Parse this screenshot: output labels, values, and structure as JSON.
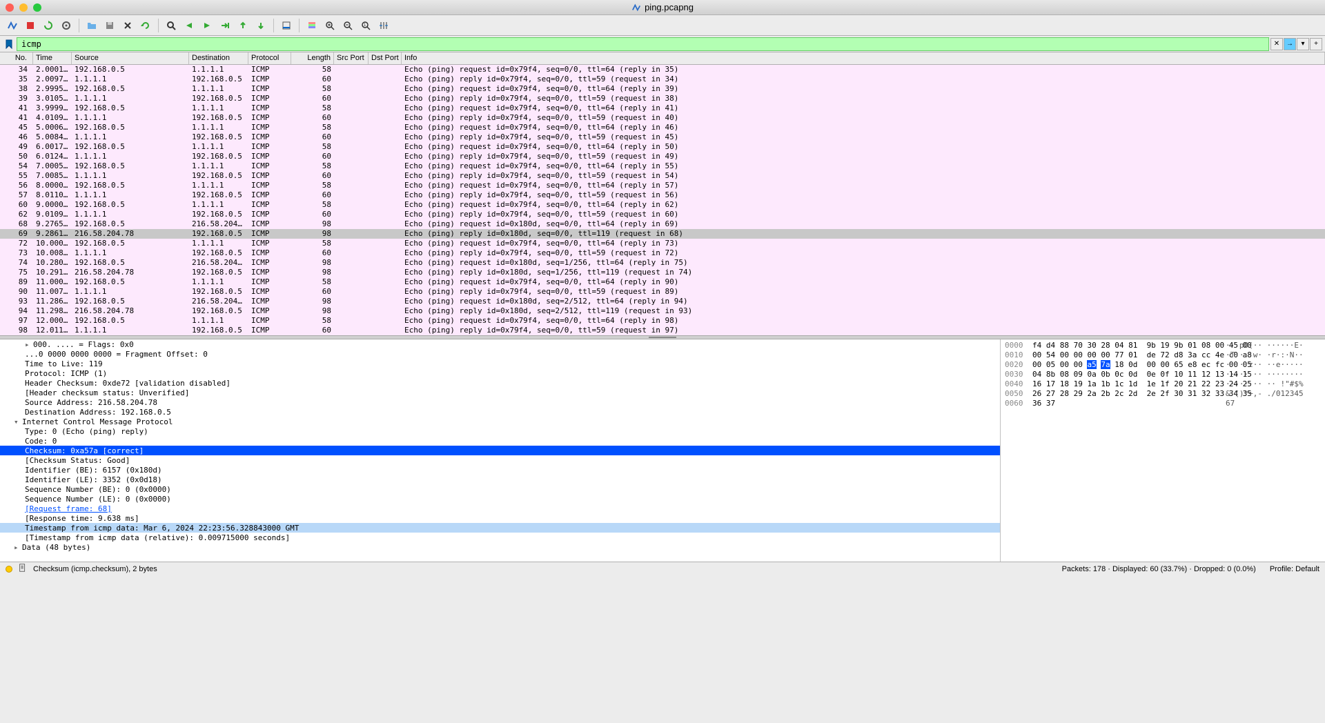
{
  "window": {
    "title": "ping.pcapng"
  },
  "filter": {
    "value": "icmp"
  },
  "columns": {
    "no": "No.",
    "time": "Time",
    "source": "Source",
    "destination": "Destination",
    "protocol": "Protocol",
    "length": "Length",
    "src_port": "Src Port",
    "dst_port": "Dst Port",
    "info": "Info"
  },
  "packets": [
    {
      "no": 34,
      "time": "2.0001…",
      "src": "192.168.0.5",
      "dst": "1.1.1.1",
      "proto": "ICMP",
      "len": 58,
      "info": "Echo (ping) request  id=0x79f4, seq=0/0, ttl=64 (reply in 35)",
      "sel": false
    },
    {
      "no": 35,
      "time": "2.0097…",
      "src": "1.1.1.1",
      "dst": "192.168.0.5",
      "proto": "ICMP",
      "len": 60,
      "info": "Echo (ping) reply    id=0x79f4, seq=0/0, ttl=59 (request in 34)",
      "sel": false
    },
    {
      "no": 38,
      "time": "2.9995…",
      "src": "192.168.0.5",
      "dst": "1.1.1.1",
      "proto": "ICMP",
      "len": 58,
      "info": "Echo (ping) request  id=0x79f4, seq=0/0, ttl=64 (reply in 39)",
      "sel": false
    },
    {
      "no": 39,
      "time": "3.0105…",
      "src": "1.1.1.1",
      "dst": "192.168.0.5",
      "proto": "ICMP",
      "len": 60,
      "info": "Echo (ping) reply    id=0x79f4, seq=0/0, ttl=59 (request in 38)",
      "sel": false
    },
    {
      "no": 41,
      "time": "3.9999…",
      "src": "192.168.0.5",
      "dst": "1.1.1.1",
      "proto": "ICMP",
      "len": 58,
      "info": "Echo (ping) request  id=0x79f4, seq=0/0, ttl=64 (reply in 41)",
      "sel": false
    },
    {
      "no": 41,
      "time": "4.0109…",
      "src": "1.1.1.1",
      "dst": "192.168.0.5",
      "proto": "ICMP",
      "len": 60,
      "info": "Echo (ping) reply    id=0x79f4, seq=0/0, ttl=59 (request in 40)",
      "sel": false
    },
    {
      "no": 45,
      "time": "5.0006…",
      "src": "192.168.0.5",
      "dst": "1.1.1.1",
      "proto": "ICMP",
      "len": 58,
      "info": "Echo (ping) request  id=0x79f4, seq=0/0, ttl=64 (reply in 46)",
      "sel": false
    },
    {
      "no": 46,
      "time": "5.0084…",
      "src": "1.1.1.1",
      "dst": "192.168.0.5",
      "proto": "ICMP",
      "len": 60,
      "info": "Echo (ping) reply    id=0x79f4, seq=0/0, ttl=59 (request in 45)",
      "sel": false
    },
    {
      "no": 49,
      "time": "6.0017…",
      "src": "192.168.0.5",
      "dst": "1.1.1.1",
      "proto": "ICMP",
      "len": 58,
      "info": "Echo (ping) request  id=0x79f4, seq=0/0, ttl=64 (reply in 50)",
      "sel": false
    },
    {
      "no": 50,
      "time": "6.0124…",
      "src": "1.1.1.1",
      "dst": "192.168.0.5",
      "proto": "ICMP",
      "len": 60,
      "info": "Echo (ping) reply    id=0x79f4, seq=0/0, ttl=59 (request in 49)",
      "sel": false
    },
    {
      "no": 54,
      "time": "7.0005…",
      "src": "192.168.0.5",
      "dst": "1.1.1.1",
      "proto": "ICMP",
      "len": 58,
      "info": "Echo (ping) request  id=0x79f4, seq=0/0, ttl=64 (reply in 55)",
      "sel": false
    },
    {
      "no": 55,
      "time": "7.0085…",
      "src": "1.1.1.1",
      "dst": "192.168.0.5",
      "proto": "ICMP",
      "len": 60,
      "info": "Echo (ping) reply    id=0x79f4, seq=0/0, ttl=59 (request in 54)",
      "sel": false
    },
    {
      "no": 56,
      "time": "8.0000…",
      "src": "192.168.0.5",
      "dst": "1.1.1.1",
      "proto": "ICMP",
      "len": 58,
      "info": "Echo (ping) request  id=0x79f4, seq=0/0, ttl=64 (reply in 57)",
      "sel": false
    },
    {
      "no": 57,
      "time": "8.0110…",
      "src": "1.1.1.1",
      "dst": "192.168.0.5",
      "proto": "ICMP",
      "len": 60,
      "info": "Echo (ping) reply    id=0x79f4, seq=0/0, ttl=59 (request in 56)",
      "sel": false
    },
    {
      "no": 60,
      "time": "9.0000…",
      "src": "192.168.0.5",
      "dst": "1.1.1.1",
      "proto": "ICMP",
      "len": 58,
      "info": "Echo (ping) request  id=0x79f4, seq=0/0, ttl=64 (reply in 62)",
      "sel": false
    },
    {
      "no": 62,
      "time": "9.0109…",
      "src": "1.1.1.1",
      "dst": "192.168.0.5",
      "proto": "ICMP",
      "len": 60,
      "info": "Echo (ping) reply    id=0x79f4, seq=0/0, ttl=59 (request in 60)",
      "sel": false
    },
    {
      "no": 68,
      "time": "9.2765…",
      "src": "192.168.0.5",
      "dst": "216.58.204…",
      "proto": "ICMP",
      "len": 98,
      "info": "Echo (ping) request  id=0x180d, seq=0/0, ttl=64 (reply in 69)",
      "sel": false
    },
    {
      "no": 69,
      "time": "9.2861…",
      "src": "216.58.204.78",
      "dst": "192.168.0.5",
      "proto": "ICMP",
      "len": 98,
      "info": "Echo (ping) reply    id=0x180d, seq=0/0, ttl=119 (request in 68)",
      "sel": true
    },
    {
      "no": 72,
      "time": "10.000…",
      "src": "192.168.0.5",
      "dst": "1.1.1.1",
      "proto": "ICMP",
      "len": 58,
      "info": "Echo (ping) request  id=0x79f4, seq=0/0, ttl=64 (reply in 73)",
      "sel": false
    },
    {
      "no": 73,
      "time": "10.008…",
      "src": "1.1.1.1",
      "dst": "192.168.0.5",
      "proto": "ICMP",
      "len": 60,
      "info": "Echo (ping) reply    id=0x79f4, seq=0/0, ttl=59 (request in 72)",
      "sel": false
    },
    {
      "no": 74,
      "time": "10.280…",
      "src": "192.168.0.5",
      "dst": "216.58.204…",
      "proto": "ICMP",
      "len": 98,
      "info": "Echo (ping) request  id=0x180d, seq=1/256, ttl=64 (reply in 75)",
      "sel": false
    },
    {
      "no": 75,
      "time": "10.291…",
      "src": "216.58.204.78",
      "dst": "192.168.0.5",
      "proto": "ICMP",
      "len": 98,
      "info": "Echo (ping) reply    id=0x180d, seq=1/256, ttl=119 (request in 74)",
      "sel": false
    },
    {
      "no": 89,
      "time": "11.000…",
      "src": "192.168.0.5",
      "dst": "1.1.1.1",
      "proto": "ICMP",
      "len": 58,
      "info": "Echo (ping) request  id=0x79f4, seq=0/0, ttl=64 (reply in 90)",
      "sel": false
    },
    {
      "no": 90,
      "time": "11.007…",
      "src": "1.1.1.1",
      "dst": "192.168.0.5",
      "proto": "ICMP",
      "len": 60,
      "info": "Echo (ping) reply    id=0x79f4, seq=0/0, ttl=59 (request in 89)",
      "sel": false
    },
    {
      "no": 93,
      "time": "11.286…",
      "src": "192.168.0.5",
      "dst": "216.58.204…",
      "proto": "ICMP",
      "len": 98,
      "info": "Echo (ping) request  id=0x180d, seq=2/512, ttl=64 (reply in 94)",
      "sel": false
    },
    {
      "no": 94,
      "time": "11.298…",
      "src": "216.58.204.78",
      "dst": "192.168.0.5",
      "proto": "ICMP",
      "len": 98,
      "info": "Echo (ping) reply    id=0x180d, seq=2/512, ttl=119 (request in 93)",
      "sel": false
    },
    {
      "no": 97,
      "time": "12.000…",
      "src": "192.168.0.5",
      "dst": "1.1.1.1",
      "proto": "ICMP",
      "len": 58,
      "info": "Echo (ping) request  id=0x79f4, seq=0/0, ttl=64 (reply in 98)",
      "sel": false
    },
    {
      "no": 98,
      "time": "12.011…",
      "src": "1.1.1.1",
      "dst": "192.168.0.5",
      "proto": "ICMP",
      "len": 60,
      "info": "Echo (ping) reply    id=0x79f4, seq=0/0, ttl=59 (request in 97)",
      "sel": false
    }
  ],
  "tree": [
    {
      "text": "000. .... = Flags: 0x0",
      "indent": 1,
      "expand": "▸"
    },
    {
      "text": "...0 0000 0000 0000 = Fragment Offset: 0",
      "indent": 1
    },
    {
      "text": "Time to Live: 119",
      "indent": 1
    },
    {
      "text": "Protocol: ICMP (1)",
      "indent": 1
    },
    {
      "text": "Header Checksum: 0xde72 [validation disabled]",
      "indent": 1
    },
    {
      "text": "[Header checksum status: Unverified]",
      "indent": 1
    },
    {
      "text": "Source Address: 216.58.204.78",
      "indent": 1
    },
    {
      "text": "Destination Address: 192.168.0.5",
      "indent": 1
    },
    {
      "text": "Internet Control Message Protocol",
      "indent": 0,
      "expand": "▾"
    },
    {
      "text": "Type: 0 (Echo (ping) reply)",
      "indent": 1
    },
    {
      "text": "Code: 0",
      "indent": 1
    },
    {
      "text": "Checksum: 0xa57a [correct]",
      "indent": 1,
      "sel": true
    },
    {
      "text": "[Checksum Status: Good]",
      "indent": 1
    },
    {
      "text": "Identifier (BE): 6157 (0x180d)",
      "indent": 1
    },
    {
      "text": "Identifier (LE): 3352 (0x0d18)",
      "indent": 1
    },
    {
      "text": "Sequence Number (BE): 0 (0x0000)",
      "indent": 1
    },
    {
      "text": "Sequence Number (LE): 0 (0x0000)",
      "indent": 1
    },
    {
      "text": "[Request frame: 68]",
      "indent": 1,
      "link": true
    },
    {
      "text": "[Response time: 9.638 ms]",
      "indent": 1
    },
    {
      "text": "Timestamp from icmp data: Mar  6, 2024 22:23:56.328843000 GMT",
      "indent": 1,
      "hl": true
    },
    {
      "text": "[Timestamp from icmp data (relative): 0.009715000 seconds]",
      "indent": 1
    },
    {
      "text": "Data (48 bytes)",
      "indent": 0,
      "expand": "▸"
    }
  ],
  "hex": [
    {
      "off": "0000",
      "bytes": "f4 d4 88 70 30 28 04 81  9b 19 9b 01 08 00 45 00",
      "ascii": "···p0(·· ······E·"
    },
    {
      "off": "0010",
      "bytes": "00 54 00 00 00 00 77 01  de 72 d8 3a cc 4e c0 a8",
      "ascii": "·T····w· ·r·:·N··"
    },
    {
      "off": "0020",
      "bytes": "00 05 00 00 a5 7a 18 0d  00 00 65 e8 ec fc 00 05",
      "ascii": "·····z·· ··e·····",
      "hl": [
        4,
        5
      ]
    },
    {
      "off": "0030",
      "bytes": "04 8b 08 09 0a 0b 0c 0d  0e 0f 10 11 12 13 14 15",
      "ascii": "········ ········"
    },
    {
      "off": "0040",
      "bytes": "16 17 18 19 1a 1b 1c 1d  1e 1f 20 21 22 23 24 25",
      "ascii": "········ ·· !\"#$%"
    },
    {
      "off": "0050",
      "bytes": "26 27 28 29 2a 2b 2c 2d  2e 2f 30 31 32 33 34 35",
      "ascii": "&'()*+,- ./012345"
    },
    {
      "off": "0060",
      "bytes": "36 37",
      "ascii": "67"
    }
  ],
  "status": {
    "left": "Checksum (icmp.checksum), 2 bytes",
    "packets": "Packets: 178 · Displayed: 60 (33.7%) · Dropped: 0 (0.0%)",
    "profile": "Profile: Default"
  },
  "toolbar_icons": {
    "start": "start-capture",
    "stop": "stop-capture",
    "restart": "restart-capture",
    "options": "capture-options",
    "open": "open-file",
    "save": "save-file",
    "close": "close-file",
    "reload": "reload",
    "find": "find-packet",
    "prev": "go-prev",
    "next": "go-next",
    "goto": "goto-packet",
    "first": "go-first",
    "last": "go-last",
    "autoscroll": "autoscroll",
    "colorize": "colorize",
    "zoomin": "zoom-in",
    "zoomout": "zoom-out",
    "zoomreset": "zoom-reset",
    "resize": "resize-cols"
  }
}
